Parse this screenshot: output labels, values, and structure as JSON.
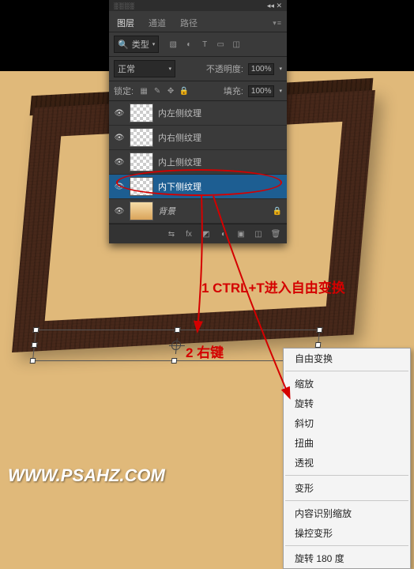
{
  "panel": {
    "tabs": {
      "layers": "图层",
      "channels": "通道",
      "paths": "路径"
    },
    "search": {
      "kind": "类型"
    },
    "blend": {
      "mode": "正常",
      "opacity_label": "不透明度:",
      "opacity": "100%"
    },
    "lock": {
      "label": "锁定:",
      "fill_label": "填充:",
      "fill": "100%"
    },
    "layers": [
      {
        "name": "内左侧纹理",
        "trans": true,
        "eye": true,
        "selected": false
      },
      {
        "name": "内右侧纹理",
        "trans": true,
        "eye": true,
        "selected": false
      },
      {
        "name": "内上侧纹理",
        "trans": true,
        "eye": true,
        "selected": false
      },
      {
        "name": "内下侧纹理",
        "trans": true,
        "eye": true,
        "selected": true
      },
      {
        "name": "背景",
        "trans": false,
        "eye": true,
        "selected": false,
        "italic": true,
        "locked": true
      }
    ]
  },
  "context_menu": {
    "items": [
      "自由变换",
      "缩放",
      "旋转",
      "斜切",
      "扭曲",
      "透视",
      "变形",
      "内容识别缩放",
      "操控变形",
      "旋转 180 度"
    ],
    "sep_after": [
      0,
      5,
      6,
      8
    ]
  },
  "annotations": {
    "a1": "1 CTRL+T进入自由变换",
    "a2": "2 右键"
  },
  "watermark": "WWW.PSAHZ.COM"
}
